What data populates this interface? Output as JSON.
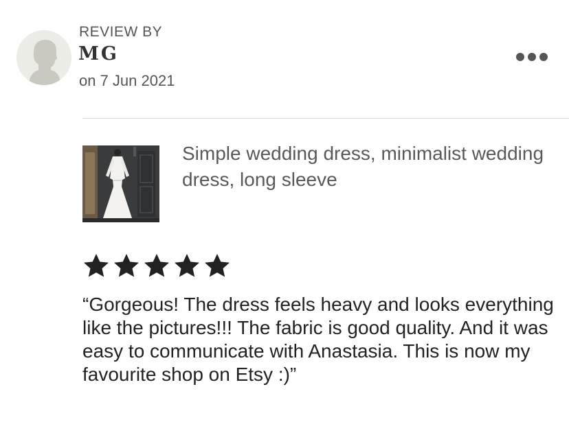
{
  "review": {
    "header_label": "REVIEW BY",
    "reviewer_name": "MG",
    "date": "on 7 Jun 2021",
    "rating": 5,
    "rating_max": 5,
    "text": "“Gorgeous! The dress feels heavy and looks everything like the pictures!!! The fabric is good quality. And it was easy to communicate with Anastasia. This is now my favourite shop on Etsy :)”"
  },
  "product": {
    "title": "Simple wedding dress, minimalist wedding dress, long sleeve"
  },
  "icons": {
    "avatar": "default-user-avatar-icon",
    "more": "more-options-icon",
    "star": "star-icon"
  },
  "colors": {
    "star": "#222222",
    "secondary_text": "#595959",
    "divider": "#d6d6d6",
    "avatar_bg": "#ecece6"
  }
}
